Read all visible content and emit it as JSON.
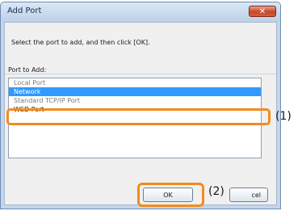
{
  "dialog": {
    "title": "Add Port",
    "close_icon": "close-icon",
    "close_glyph": "✕",
    "instruction": "Select the port to add, and then click [OK].",
    "port_label": "Port to Add:",
    "ports": [
      "Local Port",
      "Network",
      "Standard TCP/IP Port",
      "WSD Port"
    ],
    "selected_port": "Network",
    "ok_label": "OK",
    "cancel_label_visible": "cel"
  },
  "annotations": {
    "step_1": "(1)",
    "step_2": "(2)"
  },
  "colors": {
    "highlight": "#f08c1e",
    "selection": "#3399ff"
  }
}
